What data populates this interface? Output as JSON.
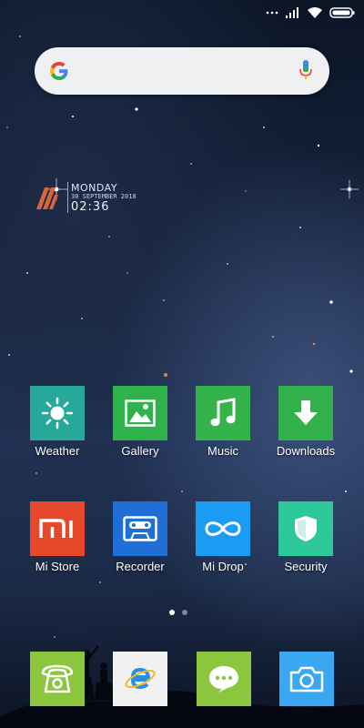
{
  "status_bar": {
    "icons": [
      "dots-icon",
      "signal-icon",
      "wifi-icon",
      "battery-icon"
    ]
  },
  "search": {
    "logo": "google-g-logo",
    "mic_icon": "mic-icon"
  },
  "clock_widget": {
    "day": "MONDAY",
    "date": "30 SEPTEMBER 2018",
    "time": "02:36"
  },
  "apps": [
    {
      "label": "Weather",
      "icon": "sun-icon",
      "color": "#26a99a"
    },
    {
      "label": "Gallery",
      "icon": "picture-icon",
      "color": "#2fb24b"
    },
    {
      "label": "Music",
      "icon": "music-note-icon",
      "color": "#34b34a"
    },
    {
      "label": "Downloads",
      "icon": "download-arrow-icon",
      "color": "#32b14b"
    },
    {
      "label": "Mi Store",
      "icon": "mi-logo-icon",
      "color": "#e5482b"
    },
    {
      "label": "Recorder",
      "icon": "cassette-icon",
      "color": "#1f6fd6"
    },
    {
      "label": "Mi Drop",
      "icon": "infinity-loop-icon",
      "color": "#1a9cf3"
    },
    {
      "label": "Security",
      "icon": "shield-icon",
      "color": "#2ec99a"
    }
  ],
  "dock": [
    {
      "name": "phone",
      "icon": "telephone-icon",
      "color": "#8cc63f"
    },
    {
      "name": "browser",
      "icon": "browser-e-icon",
      "color": "#f1f1f1"
    },
    {
      "name": "messaging",
      "icon": "chat-bubble-icon",
      "color": "#8cc63f"
    },
    {
      "name": "camera",
      "icon": "camera-icon",
      "color": "#3aa7f2"
    }
  ],
  "page_indicator": {
    "current": 1,
    "total": 2
  }
}
